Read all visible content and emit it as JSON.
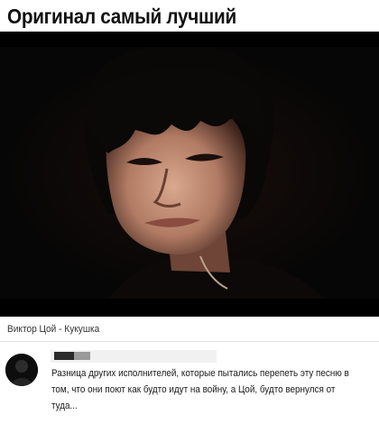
{
  "post": {
    "headline": "Оригинал самый лучший",
    "video_caption": "Виктор Цой - Кукушка"
  },
  "comment": {
    "text": "Разница других исполнителей, которые пытались перепеть эту песню в том, что они поют как будто идут на войну, а Цой, будто вернулся от туда..."
  },
  "colors": {
    "text": "#111111",
    "video_background": "#060606",
    "author_bar": "#f1f1f1"
  }
}
